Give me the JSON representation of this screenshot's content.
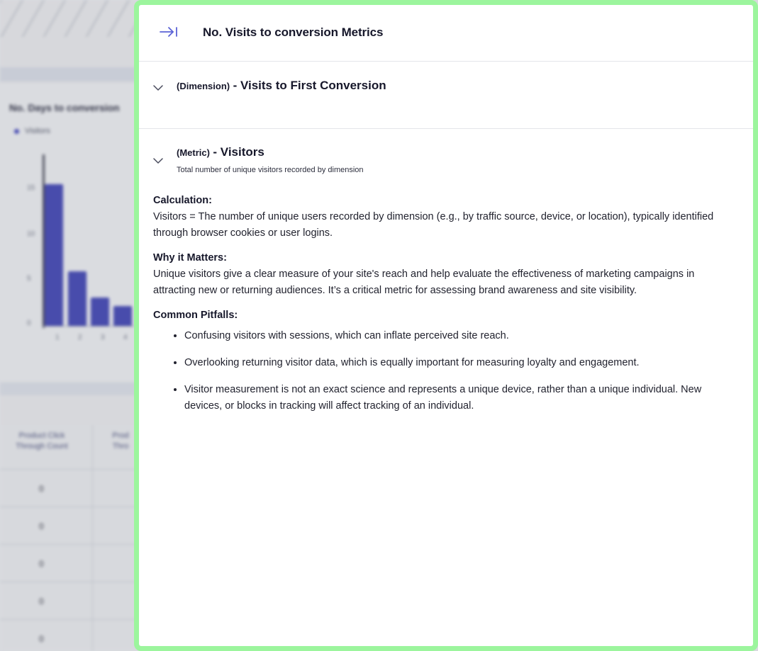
{
  "background": {
    "chart_title": "No. Days to conversion",
    "legend_label": "Visitors",
    "y_ticks": [
      "15",
      "10",
      "5",
      "0"
    ],
    "x_ticks": [
      "1",
      "2",
      "3",
      "4"
    ],
    "table_headers": [
      "Product Click Through Count",
      "Prod Thro"
    ],
    "table_cells": [
      "0",
      "0",
      "0",
      "0",
      "0"
    ]
  },
  "drawer": {
    "title": "No. Visits to conversion Metrics",
    "dimension": {
      "tag": "(Dimension)",
      "name": "- Visits to First Conversion"
    },
    "metric": {
      "tag": "(Metric)",
      "name": "- Visitors",
      "subtitle": "Total number of unique visitors recorded by dimension",
      "calculation_title": "Calculation:",
      "calculation_text": "Visitors = The number of unique users recorded by dimension (e.g., by traffic source, device, or location), typically identified through browser cookies or user logins.",
      "why_title": "Why it Matters:",
      "why_text": "Unique visitors give a clear measure of your site's reach and help evaluate the effectiveness of marketing campaigns in attracting new or returning audiences. It’s a critical metric for assessing brand awareness and site visibility.",
      "pitfalls_title": "Common Pitfalls:",
      "pitfalls": [
        "Confusing visitors with sessions, which can inflate perceived site reach.",
        "Overlooking returning visitor data, which is equally important for measuring loyalty and engagement.",
        "Visitor measurement is not an exact science and represents a unique device, rather than a unique individual. New devices, or blocks in tracking will affect tracking of an individual."
      ]
    }
  },
  "colors": {
    "accent": "#5b63d6",
    "drawer_border": "#9cf59d",
    "bar": "#3b3fb8"
  },
  "icons": {
    "collapse": "collapse-right-icon",
    "chevron": "chevron-down-icon"
  }
}
